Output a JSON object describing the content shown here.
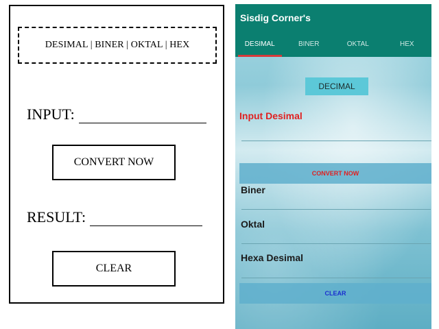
{
  "wireframe": {
    "tabs_text": "DESIMAL | BINER | OKTAL | HEX",
    "input_label": "INPUT:",
    "convert_label": "CONVERT NOW",
    "result_label": "RESULT:",
    "clear_label": "CLEAR"
  },
  "app": {
    "title": "Sisdig Corner's",
    "tabs": [
      {
        "label": "DESIMAL",
        "active": true
      },
      {
        "label": "BINER",
        "active": false
      },
      {
        "label": "OKTAL",
        "active": false
      },
      {
        "label": "HEX",
        "active": false
      }
    ],
    "section_badge": "DECIMAL",
    "input_label": "Input Desimal",
    "input_value": "",
    "convert_label": "CONVERT NOW",
    "results": {
      "biner_label": "Biner",
      "oktal_label": "Oktal",
      "hexa_label": "Hexa Desimal"
    },
    "clear_label": "CLEAR",
    "colors": {
      "appbar": "#0b7f70",
      "tab_indicator": "#d83a3a",
      "input_label": "#e02020",
      "convert_text": "#e02020",
      "clear_text": "#1a2fcf"
    }
  }
}
